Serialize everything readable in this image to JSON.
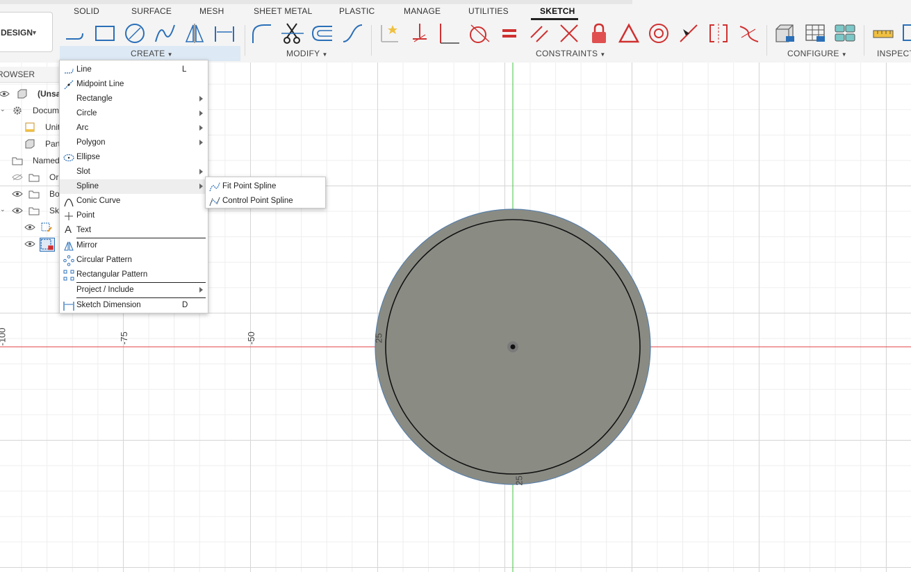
{
  "toolbar": {
    "workspace": "DESIGN",
    "tabs": [
      "SOLID",
      "SURFACE",
      "MESH",
      "SHEET METAL",
      "PLASTIC",
      "MANAGE",
      "UTILITIES",
      "SKETCH"
    ],
    "active_tab": "SKETCH",
    "groups": {
      "create": "CREATE",
      "modify": "MODIFY",
      "constraints": "CONSTRAINTS",
      "configure": "CONFIGURE",
      "inspect": "INSPECT"
    }
  },
  "browser": {
    "header": "ROWSER",
    "items": [
      {
        "label": "(Unsa"
      },
      {
        "label": "Docum"
      },
      {
        "label": "Unit"
      },
      {
        "label": "Part"
      },
      {
        "label": "Named"
      },
      {
        "label": "Or"
      },
      {
        "label": "Bo"
      },
      {
        "label": "Sk"
      }
    ]
  },
  "create_menu": {
    "items": [
      {
        "label": "Line",
        "shortcut": "L"
      },
      {
        "label": "Midpoint Line"
      },
      {
        "label": "Rectangle"
      },
      {
        "label": "Circle"
      },
      {
        "label": "Arc"
      },
      {
        "label": "Polygon"
      },
      {
        "label": "Ellipse"
      },
      {
        "label": "Slot"
      },
      {
        "label": "Spline"
      },
      {
        "label": "Conic Curve"
      },
      {
        "label": "Point"
      },
      {
        "label": "Text"
      },
      {
        "label": "Mirror"
      },
      {
        "label": "Circular Pattern"
      },
      {
        "label": "Rectangular Pattern"
      },
      {
        "label": "Project / Include"
      },
      {
        "label": "Sketch Dimension",
        "shortcut": "D"
      }
    ],
    "highlighted": "Spline"
  },
  "spline_menu": {
    "items": [
      {
        "label": "Fit Point Spline"
      },
      {
        "label": "Control Point Spline"
      }
    ]
  },
  "canvas": {
    "axis_labels": [
      "-100",
      "-75",
      "-50",
      "25",
      "25"
    ]
  },
  "colors": {
    "x_axis": "#e04040",
    "y_axis": "#40c040",
    "profile_fill": "#8a8c84",
    "constraint_red": "#d03030",
    "tool_blue": "#2a6fb8"
  }
}
